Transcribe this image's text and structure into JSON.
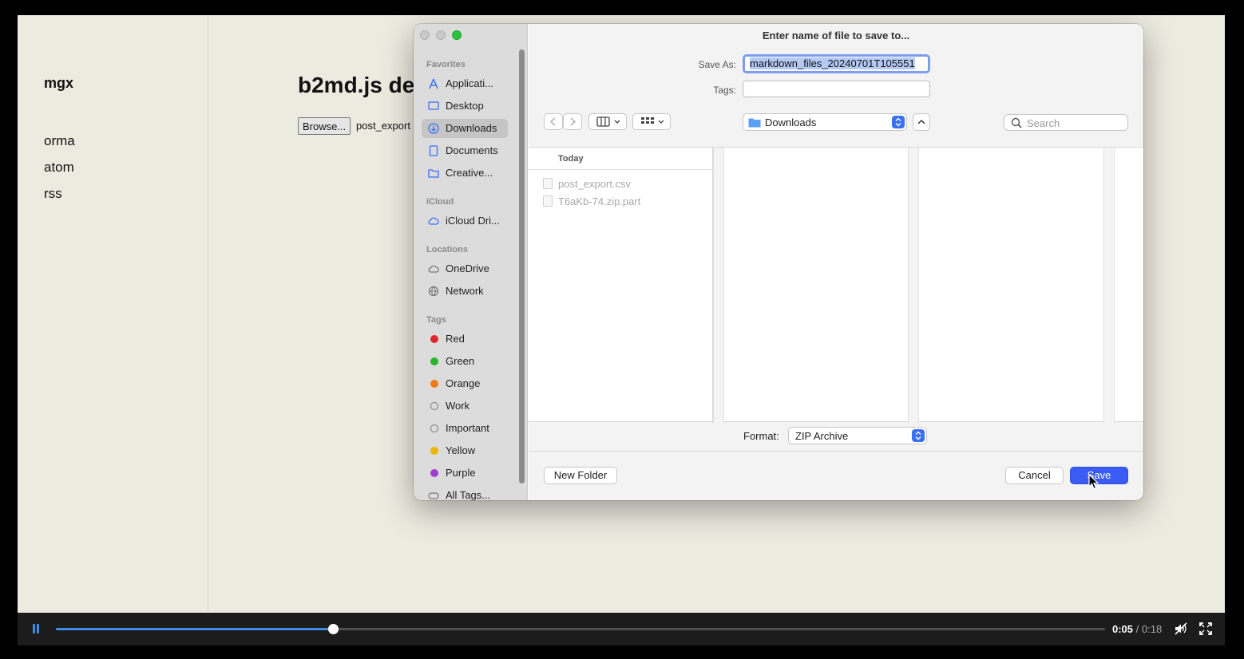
{
  "background_page": {
    "site_title": "mgx",
    "nav": [
      "orma",
      "atom",
      "rss"
    ],
    "heading": "b2md.js de",
    "browse_label": "Browse...",
    "selected_file": "post_export"
  },
  "dialog": {
    "title": "Enter name of file to save to...",
    "save_as_label": "Save As:",
    "save_as_value": "markdown_files_20240701T105551",
    "tags_label": "Tags:",
    "location": "Downloads",
    "search_placeholder": "Search",
    "column_header": "Today",
    "files": [
      "post_export.csv",
      "T6aKb-74.zip.part"
    ],
    "format_label": "Format:",
    "format_value": "ZIP Archive",
    "new_folder_label": "New Folder",
    "cancel_label": "Cancel",
    "save_label": "Save"
  },
  "sidebar": {
    "favorites_title": "Favorites",
    "favorites": [
      "Applicati...",
      "Desktop",
      "Downloads",
      "Documents",
      "Creative..."
    ],
    "icloud_title": "iCloud",
    "icloud": [
      "iCloud Dri..."
    ],
    "locations_title": "Locations",
    "locations": [
      "OneDrive",
      "Network"
    ],
    "tags_title": "Tags",
    "tags": [
      {
        "label": "Red",
        "color": "#e0262d"
      },
      {
        "label": "Green",
        "color": "#2bb32d"
      },
      {
        "label": "Orange",
        "color": "#ed7d1b"
      },
      {
        "label": "Work",
        "color": ""
      },
      {
        "label": "Important",
        "color": ""
      },
      {
        "label": "Yellow",
        "color": "#e9b700"
      },
      {
        "label": "Purple",
        "color": "#9d3fd0"
      },
      {
        "label": "All Tags...",
        "color": ""
      }
    ]
  },
  "video": {
    "current_time": "0:05",
    "separator": " / ",
    "total_time": "0:18",
    "progress_fraction": 0.264
  },
  "colors": {
    "accent": "#3a5cf5",
    "player_progress": "#3b8ee8"
  }
}
